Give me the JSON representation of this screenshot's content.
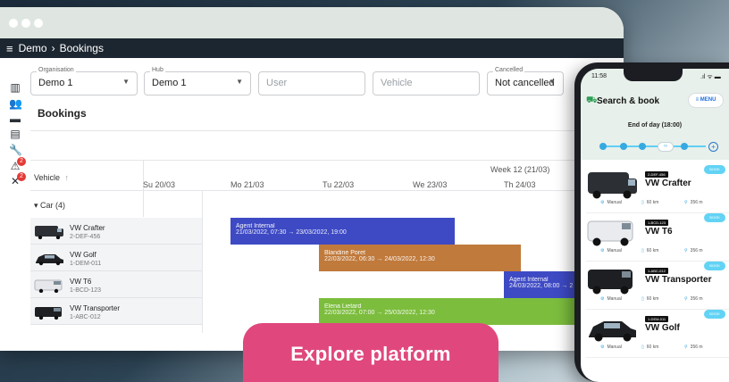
{
  "desktop": {
    "breadcrumb": {
      "root": "Demo",
      "separator": "›",
      "current": "Bookings"
    },
    "filters": {
      "organisation": {
        "label": "Organisation",
        "value": "Demo 1"
      },
      "hub": {
        "label": "Hub",
        "value": "Demo 1"
      },
      "user": {
        "placeholder": "User"
      },
      "vehicle": {
        "placeholder": "Vehicle"
      },
      "cancelled": {
        "label": "Cancelled",
        "value": "Not cancelled"
      }
    },
    "panel_title": "Bookings",
    "vehicle_column": "Vehicle",
    "sort_icon": "↑",
    "week_label": "Week 12 (21/03)",
    "days": [
      "Su 20/03",
      "Mo 21/03",
      "Tu 22/03",
      "We 23/03",
      "Th 24/03"
    ],
    "group": "Car (4)",
    "vehicles": [
      {
        "name": "VW Crafter",
        "plate": "2-DEF-456"
      },
      {
        "name": "VW Golf",
        "plate": "1-DEM-011"
      },
      {
        "name": "VW T6",
        "plate": "1-BCD-123"
      },
      {
        "name": "VW Transporter",
        "plate": "1-ABC-012"
      }
    ],
    "bookings": [
      {
        "name": "Agent Internal",
        "time": "21/03/2022, 07:30 → 23/03/2022, 19:00",
        "color": "#3e4ac4"
      },
      {
        "name": "Blandine Poret",
        "time": "22/03/2022, 06:30 → 24/03/2022, 12:30",
        "color": "#c07a3c"
      },
      {
        "name": "Agent Internal",
        "time": "24/03/2022, 08:00 → 2",
        "color": "#3e4ac4"
      },
      {
        "name": "Elena Lietard",
        "time": "22/03/2022, 07:00 → 25/03/2022, 12:30",
        "color": "#7cbd3d"
      }
    ],
    "notification_badges": [
      "2",
      "2"
    ]
  },
  "cta_label": "Explore platform",
  "phone": {
    "time": "11:58",
    "title": "Search & book",
    "menu_label": "MENU",
    "end_of_day": "End of day (18:00)",
    "book_label": "BOOK",
    "cards": [
      {
        "plate": "2-DEF-456",
        "name": "VW Crafter",
        "transmission": "Manual",
        "range": "60 km",
        "distance": "356 m"
      },
      {
        "plate": "1-BCD-123",
        "name": "VW T6",
        "transmission": "Manual",
        "range": "60 km",
        "distance": "356 m"
      },
      {
        "plate": "1-ABC-012",
        "name": "VW Transporter",
        "transmission": "Manual",
        "range": "60 km",
        "distance": "356 m"
      },
      {
        "plate": "1-DEM-011",
        "name": "VW Golf",
        "transmission": "Manual",
        "range": "60 km",
        "distance": "356 m"
      }
    ]
  },
  "colors": {
    "cta": "#e0487d",
    "accent": "#36a9e1",
    "appbar": "#1c2630",
    "badge": "#e53935"
  }
}
